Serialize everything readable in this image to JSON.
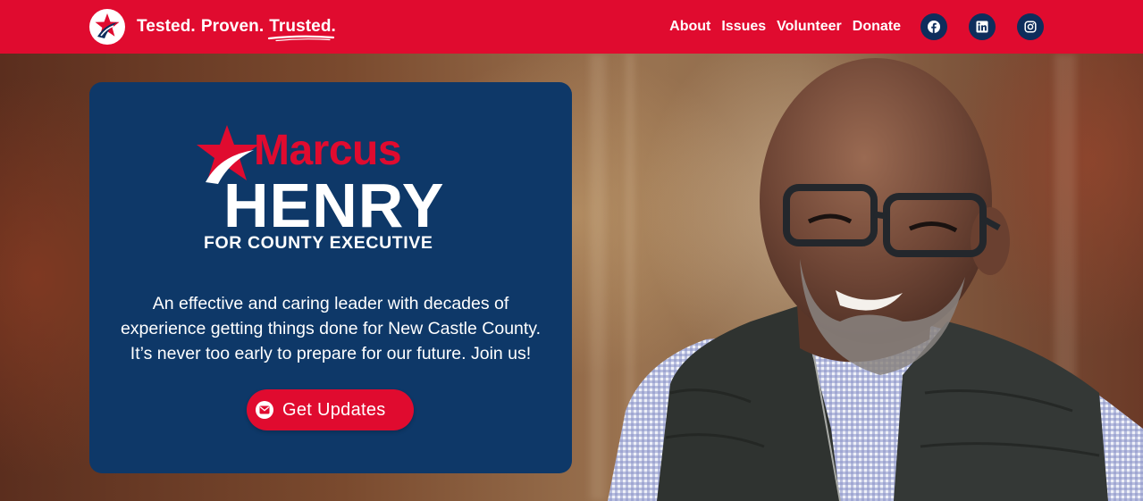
{
  "header": {
    "logo_icon": "star-circle-logo-icon",
    "tagline": {
      "word1": "Tested.",
      "word2": "Proven.",
      "word3": "Trusted."
    },
    "nav": [
      "About",
      "Issues",
      "Volunteer",
      "Donate"
    ],
    "social": [
      "facebook-icon",
      "linkedin-icon",
      "instagram-icon"
    ]
  },
  "hero": {
    "logo": {
      "first_name": "Marcus",
      "last_name": "HENRY",
      "office": "FOR COUNTY EXECUTIVE"
    },
    "intro": {
      "line1": "An effective and caring leader with decades of",
      "line2": "experience getting things done for New Castle County.",
      "line3": "It’s never too early to prepare for our future. Join us!"
    },
    "cta": {
      "label": "Get Updates",
      "icon": "mail-icon"
    }
  },
  "colors": {
    "primary_red": "#e00b2f",
    "navy": "#0e3868",
    "dark_navy": "#0e2d5c",
    "white": "#ffffff"
  }
}
